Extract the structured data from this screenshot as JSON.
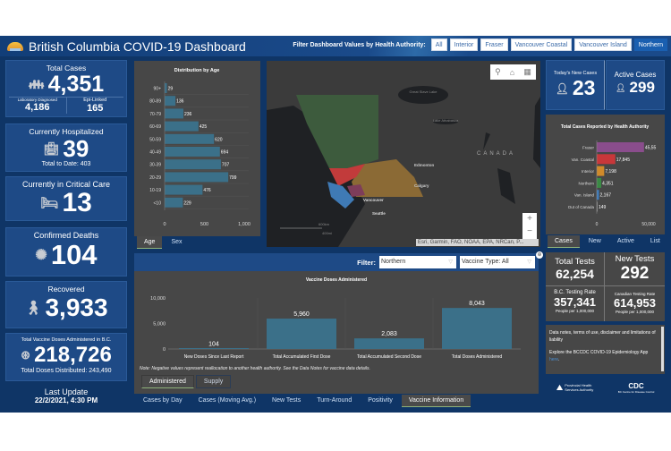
{
  "header": {
    "title": "British Columbia COVID-19 Dashboard",
    "filter_label": "Filter Dashboard Values by Health Authority:",
    "filters": [
      "All",
      "Interior",
      "Fraser",
      "Vancouver Coastal",
      "Vancouver Island",
      "Northern"
    ],
    "active_filter": "Northern"
  },
  "left": {
    "total_cases": {
      "label": "Total Cases",
      "value": "4,351",
      "lab_label": "Laboratory Diagnosed",
      "lab_value": "4,186",
      "epi_label": "Epi-Linked",
      "epi_value": "165"
    },
    "hospitalized": {
      "label": "Currently Hospitalized",
      "value": "39",
      "sub": "Total to Date: 403"
    },
    "critical": {
      "label": "Currently in Critical Care",
      "value": "13"
    },
    "deaths": {
      "label": "Confirmed Deaths",
      "value": "104"
    },
    "recovered": {
      "label": "Recovered",
      "value": "3,933"
    },
    "vaccine": {
      "label": "Total Vaccine Doses Administered in B.C.",
      "value": "218,726",
      "sub": "Total Doses Distributed: 243,490"
    },
    "last_update": {
      "label": "Last Update",
      "value": "22/2/2021, 4:30 PM"
    }
  },
  "age_panel": {
    "tabs": [
      "Age",
      "Sex"
    ],
    "active_tab": "Age"
  },
  "map": {
    "labels": {
      "edmonton": "Edmonton",
      "calgary": "Calgary",
      "vancouver": "Vancouver",
      "seattle": "Seattle",
      "canada": "CANADA",
      "great_slave": "Great Slave Lake",
      "athabasca": "Lake Athabasca"
    },
    "scale_km": "600km",
    "scale_mi": "400mi",
    "attribution": "Esri, Garmin, FAO, NOAA, EPA, NRCan, P...",
    "zoom_in": "+",
    "zoom_out": "−"
  },
  "right": {
    "new_cases": {
      "label": "Today's New Cases",
      "value": "23"
    },
    "active_cases": {
      "label": "Active Cases",
      "value": "299"
    },
    "ha_tabs": [
      "Cases",
      "New",
      "Active",
      "List"
    ],
    "ha_active_tab": "Cases",
    "total_tests": {
      "label": "Total Tests",
      "value": "62,254"
    },
    "new_tests": {
      "label": "New Tests",
      "value": "292"
    },
    "bc_rate": {
      "label": "B.C. Testing Rate",
      "value": "357,341",
      "sub": "People per 1,000,000"
    },
    "can_rate": {
      "label": "Canadian Testing Rate",
      "value": "614,953",
      "sub": "People per 1,000,000"
    },
    "notes": {
      "line1": "Data notes, terms of use, disclaimer and limitations of liability",
      "line2": "Explore the BCCDC COVID-19 Epidemiology App ",
      "link": "here",
      "tail": "."
    },
    "logos": {
      "phsa": "Provincial Health Services Authority",
      "bccdc": "BC Centre for Disease Control"
    }
  },
  "vaccine_panel": {
    "filter_label": "Filter:",
    "filter_value": "Northern",
    "vaccine_type": "Vaccine Type: All",
    "note": "Note: Negative values represent reallocation to another health authority. See the Data Notes for vaccine data details.",
    "sub_tabs": [
      "Administered",
      "Supply"
    ],
    "active_sub_tab": "Administered"
  },
  "bottom_tabs": [
    "Cases by Day",
    "Cases (Moving Avg.)",
    "New Tests",
    "Turn-Around",
    "Positivity",
    "Vaccine Information"
  ],
  "bottom_active": "Vaccine Information",
  "chart_data": [
    {
      "type": "bar",
      "orientation": "horizontal",
      "title": "Distribution by Age",
      "categories": [
        "90+",
        "80-89",
        "70-79",
        "60-69",
        "50-59",
        "40-49",
        "30-39",
        "20-29",
        "10-19",
        "<10"
      ],
      "values": [
        29,
        136,
        236,
        425,
        620,
        694,
        707,
        799,
        476,
        229
      ],
      "xlim": [
        0,
        1000
      ],
      "xticks": [
        "0",
        "500",
        "1,000"
      ],
      "color": "#3b7089"
    },
    {
      "type": "bar",
      "orientation": "horizontal",
      "title": "Total Cases Reported by Health Authority",
      "categories": [
        "Fraser",
        "Van. Coastal",
        "Interior",
        "Northern",
        "Van. Island",
        "Out of Canada"
      ],
      "values": [
        45550,
        17845,
        7198,
        4351,
        2167,
        149
      ],
      "value_labels": [
        "45,55",
        "17,845",
        "7,198",
        "4,351",
        "2,167",
        "149"
      ],
      "colors": [
        "#8a4d8c",
        "#c8373a",
        "#d08a2a",
        "#3a8a44",
        "#3b7cc0",
        "#888888"
      ],
      "xlim": [
        0,
        50000
      ],
      "xticks": [
        "0",
        "50,000"
      ]
    },
    {
      "type": "bar",
      "title": "Vaccine Doses Administered",
      "categories": [
        "New Doses Since Last Report",
        "Total Accumulated First Dose",
        "Total Accumulated Second Dose",
        "Total Doses Administered"
      ],
      "values": [
        104,
        5960,
        2083,
        8043
      ],
      "value_labels": [
        "104",
        "5,960",
        "2,083",
        "8,043"
      ],
      "ylim": [
        0,
        10000
      ],
      "yticks": [
        "0",
        "5,000",
        "10,000"
      ],
      "color": "#3b7089"
    }
  ]
}
